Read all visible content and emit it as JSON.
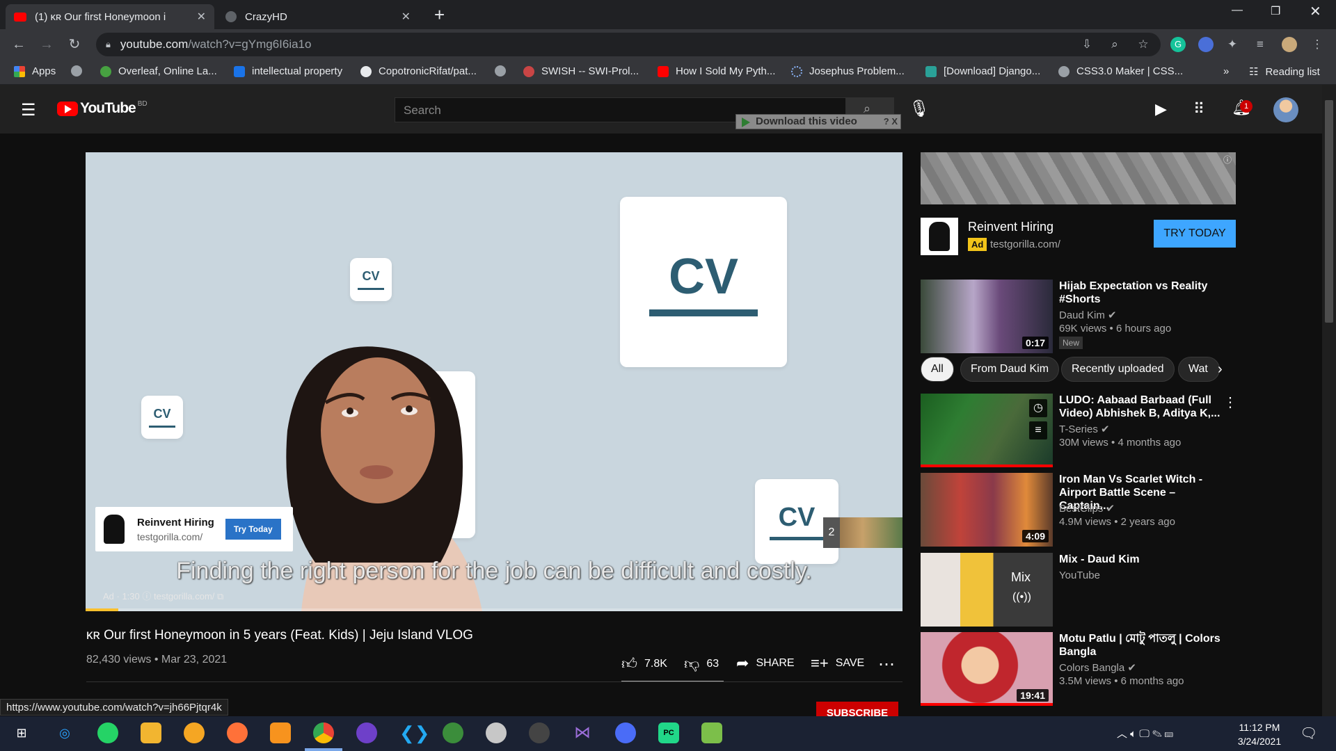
{
  "browser": {
    "tabs": [
      {
        "title": "(1) ᴋʀ Our first Honeymoon i",
        "active": true
      },
      {
        "title": "CrazyHD",
        "active": false
      }
    ],
    "new_tab": "+",
    "url_host": "youtube.com",
    "url_path": "/watch?v=gYmg6I6ia1o",
    "bookmarks": [
      "Apps",
      "Overleaf, Online La...",
      "intellectual property",
      "CopotronicRifat/pat...",
      "SWISH -- SWI-Prol...",
      "How I Sold My Pyth...",
      "Josephus Problem...",
      "[Download] Django...",
      "CSS3.0 Maker | CSS..."
    ],
    "bookmarks_more": "»",
    "reading_list": "Reading list"
  },
  "youtube": {
    "logo_text": "YouTube",
    "region": "BD",
    "search_placeholder": "Search",
    "notifications_count": "1",
    "download_overlay": "Download this video",
    "download_overlay_controls": "? X"
  },
  "video": {
    "caption": "Finding the right person for the job can be difficult and costly.",
    "cv_label": "CV",
    "ad_card": {
      "title": "Reinvent Hiring",
      "url": "testgorilla.com/",
      "button": "Try Today"
    },
    "ad_tiny": "Ad · 1:30 ⓘ   testgorilla.com/ ⧉",
    "skip_count": "2",
    "progress": 0.04,
    "title": "ᴋʀ Our first Honeymoon in 5 years (Feat. Kids) | Jeju Island VLOG",
    "meta": "82,430 views • Mar 23, 2021",
    "likes": "7.8K",
    "dislikes": "63",
    "share": "SHARE",
    "save": "SAVE",
    "subscribe": "SUBSCRIBE",
    "status_url": "https://www.youtube.com/watch?v=jh66Pjtqr4k"
  },
  "sidebar": {
    "ad": {
      "title": "Reinvent Hiring",
      "badge": "Ad",
      "url": "testgorilla.com/",
      "button": "TRY TODAY"
    },
    "chips": [
      "All",
      "From Daud Kim",
      "Recently uploaded",
      "Wat"
    ],
    "videos": [
      {
        "title": "Hijab Expectation vs Reality #Shorts",
        "channel": "Daud Kim",
        "views": "69K views • 6 hours ago",
        "badge": "New",
        "duration": "0:17"
      },
      {
        "title": "LUDO: Aabaad Barbaad (Full Video) Abhishek B, Aditya K,...",
        "channel": "T-Series",
        "views": "30M views • 4 months ago"
      },
      {
        "title": "Iron Man Vs Scarlet Witch - Airport Battle Scene – Captain...",
        "channel": "BestClips",
        "views": "4.9M views • 2 years ago",
        "duration": "4:09"
      },
      {
        "title": "Mix - Daud Kim",
        "channel": "YouTube",
        "mix_label": "Mix"
      },
      {
        "title": "Motu Patlu | মোটু পাতলু | Colors Bangla",
        "channel": "Colors Bangla",
        "views": "3.5M views • 6 months ago",
        "duration": "19:41"
      }
    ]
  },
  "taskbar": {
    "time": "11:12 PM",
    "date": "3/24/2021"
  }
}
